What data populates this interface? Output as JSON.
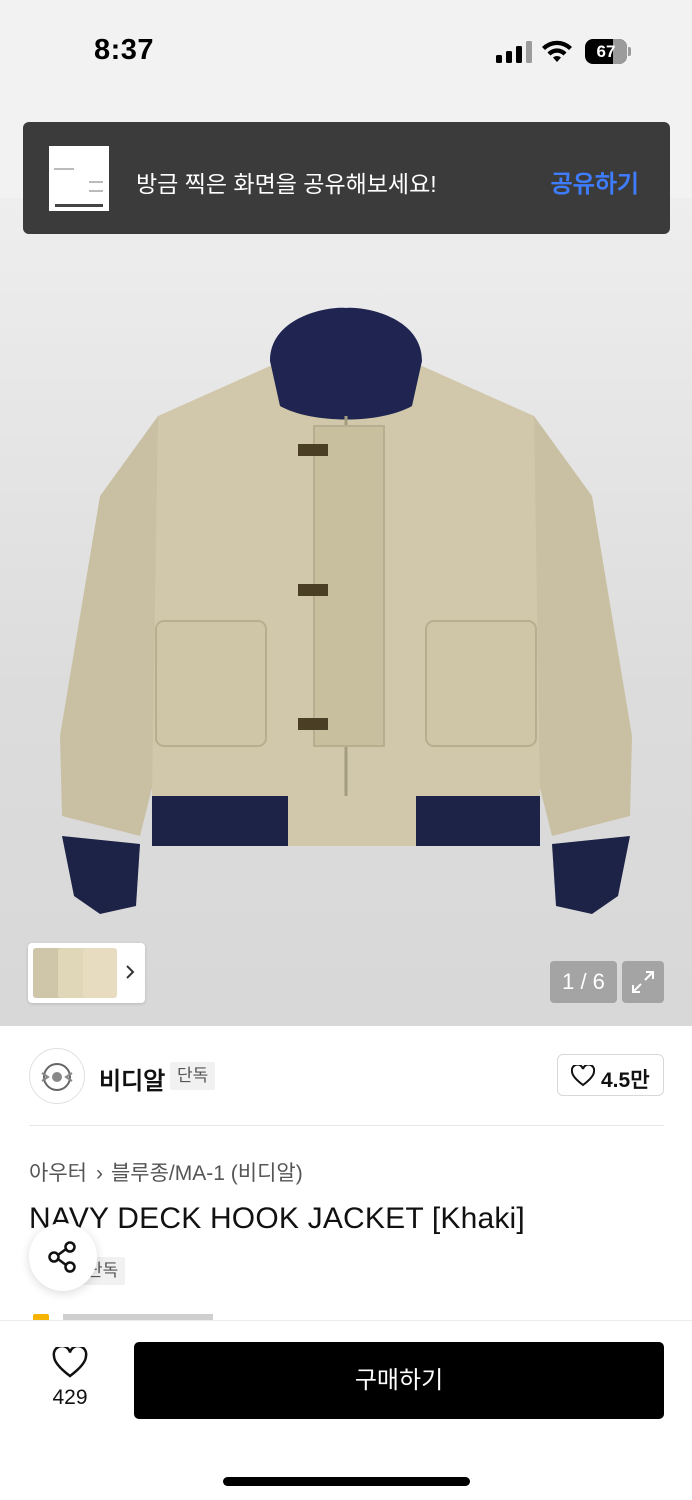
{
  "status_bar": {
    "time": "8:37",
    "battery": "67",
    "battery_fraction": 0.67
  },
  "toast": {
    "message": "방금 찍은 화면을 공유해보세요!",
    "action": "공유하기"
  },
  "gallery": {
    "counter": "1 / 6"
  },
  "brand": {
    "name": "비디알",
    "badge": "단독",
    "likes": "4.5만"
  },
  "product": {
    "breadcrumb": [
      "아우터",
      "블루종/MA-1 (비디알)"
    ],
    "title": "NAVY DECK HOOK JACKET [Khaki]",
    "badge": "단독"
  },
  "bottom_bar": {
    "wish_count": "429",
    "buy_label": "구매하기"
  },
  "colors": {
    "accent": "#3e7dff",
    "toast_bg": "#3b3b3b",
    "buy_button": "#000000"
  }
}
